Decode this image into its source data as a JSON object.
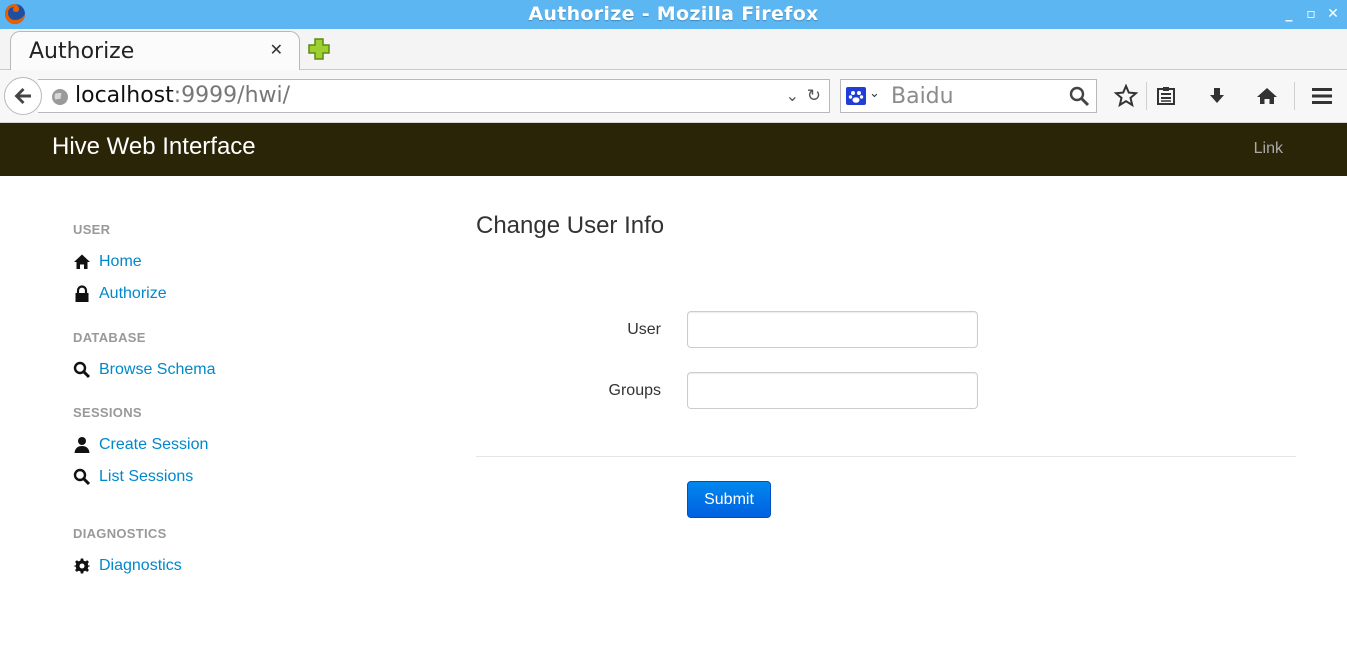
{
  "window": {
    "title": "Authorize - Mozilla Firefox"
  },
  "tabs": [
    {
      "label": "Authorize",
      "active": true
    }
  ],
  "navbar": {
    "url_host": "localhost",
    "url_rest": ":9999/hwi/",
    "search_placeholder": "Baidu"
  },
  "header": {
    "brand": "Hive Web Interface",
    "link": "Link",
    "bg_color": "#2b2508"
  },
  "sidebar": {
    "sections": [
      {
        "header": "USER",
        "items": [
          {
            "label": "Home",
            "icon": "home-icon"
          },
          {
            "label": "Authorize",
            "icon": "lock-icon"
          }
        ]
      },
      {
        "header": "DATABASE",
        "items": [
          {
            "label": "Browse Schema",
            "icon": "search-icon"
          }
        ]
      },
      {
        "header": "SESSIONS",
        "items": [
          {
            "label": "Create Session",
            "icon": "user-icon"
          },
          {
            "label": "List Sessions",
            "icon": "search-icon"
          }
        ]
      },
      {
        "header": "DIAGNOSTICS",
        "items": [
          {
            "label": "Diagnostics",
            "icon": "gear-icon"
          }
        ]
      }
    ]
  },
  "main": {
    "title": "Change User Info",
    "fields": [
      {
        "label": "User",
        "value": ""
      },
      {
        "label": "Groups",
        "value": ""
      }
    ],
    "submit_label": "Submit",
    "accent_color": "#0088cc"
  }
}
